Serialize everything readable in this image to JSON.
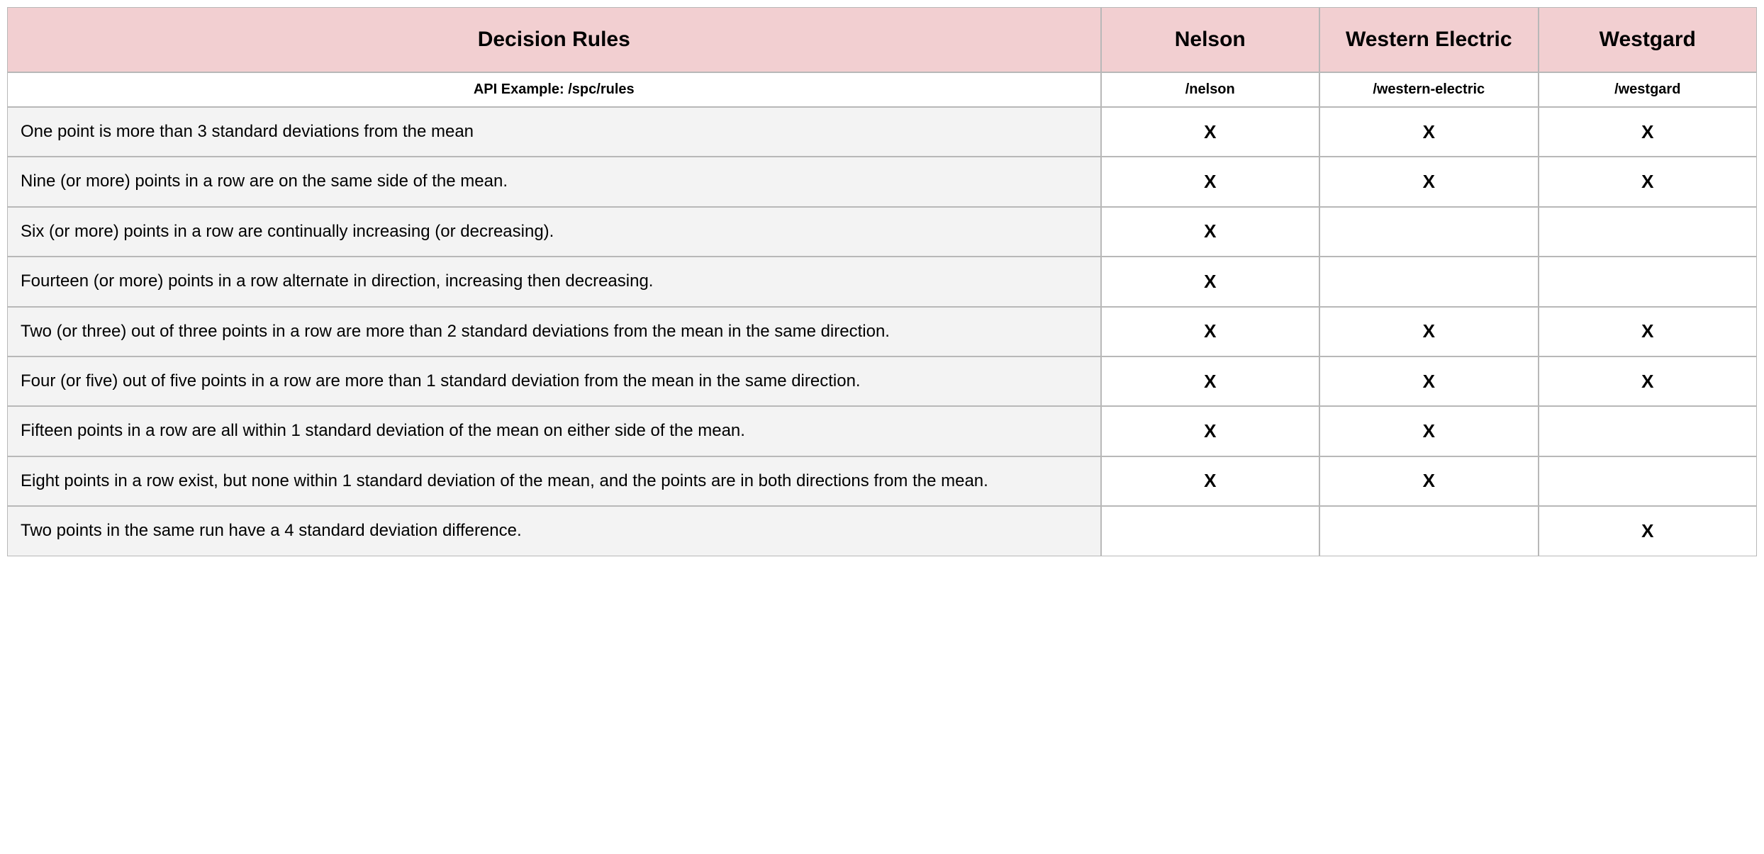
{
  "header": {
    "main": "Decision Rules",
    "cols": [
      "Nelson",
      "Western Electric",
      "Westgard"
    ]
  },
  "api_row": {
    "label": "API Example:  /spc/rules",
    "paths": [
      "/nelson",
      "/western-electric",
      "/westgard"
    ]
  },
  "mark": "X",
  "rules": [
    {
      "desc": "One point is more than 3 standard deviations from the mean",
      "nelson": true,
      "western": true,
      "westgard": true
    },
    {
      "desc": "Nine (or more) points in a row are on the same side of the mean.",
      "nelson": true,
      "western": true,
      "westgard": true
    },
    {
      "desc": "Six (or more) points in a row are continually increasing (or decreasing).",
      "nelson": true,
      "western": false,
      "westgard": false
    },
    {
      "desc": "Fourteen (or more) points in a row alternate in direction, increasing then decreasing.",
      "nelson": true,
      "western": false,
      "westgard": false
    },
    {
      "desc": "Two (or three) out of three points in a row are more than 2 standard deviations from the mean in the same direction.",
      "nelson": true,
      "western": true,
      "westgard": true
    },
    {
      "desc": "Four (or five) out of five points in a row are more than 1 standard deviation from the mean in the same direction.",
      "nelson": true,
      "western": true,
      "westgard": true
    },
    {
      "desc": "Fifteen points in a row are all within 1 standard deviation of the mean on either side of the mean.",
      "nelson": true,
      "western": true,
      "westgard": false
    },
    {
      "desc": "Eight points in a row exist, but none within 1 standard deviation of the mean, and the points are in both directions from the mean.",
      "nelson": true,
      "western": true,
      "westgard": false
    },
    {
      "desc": "Two points in the same run have a 4 standard deviation difference.",
      "nelson": false,
      "western": false,
      "westgard": true
    }
  ]
}
